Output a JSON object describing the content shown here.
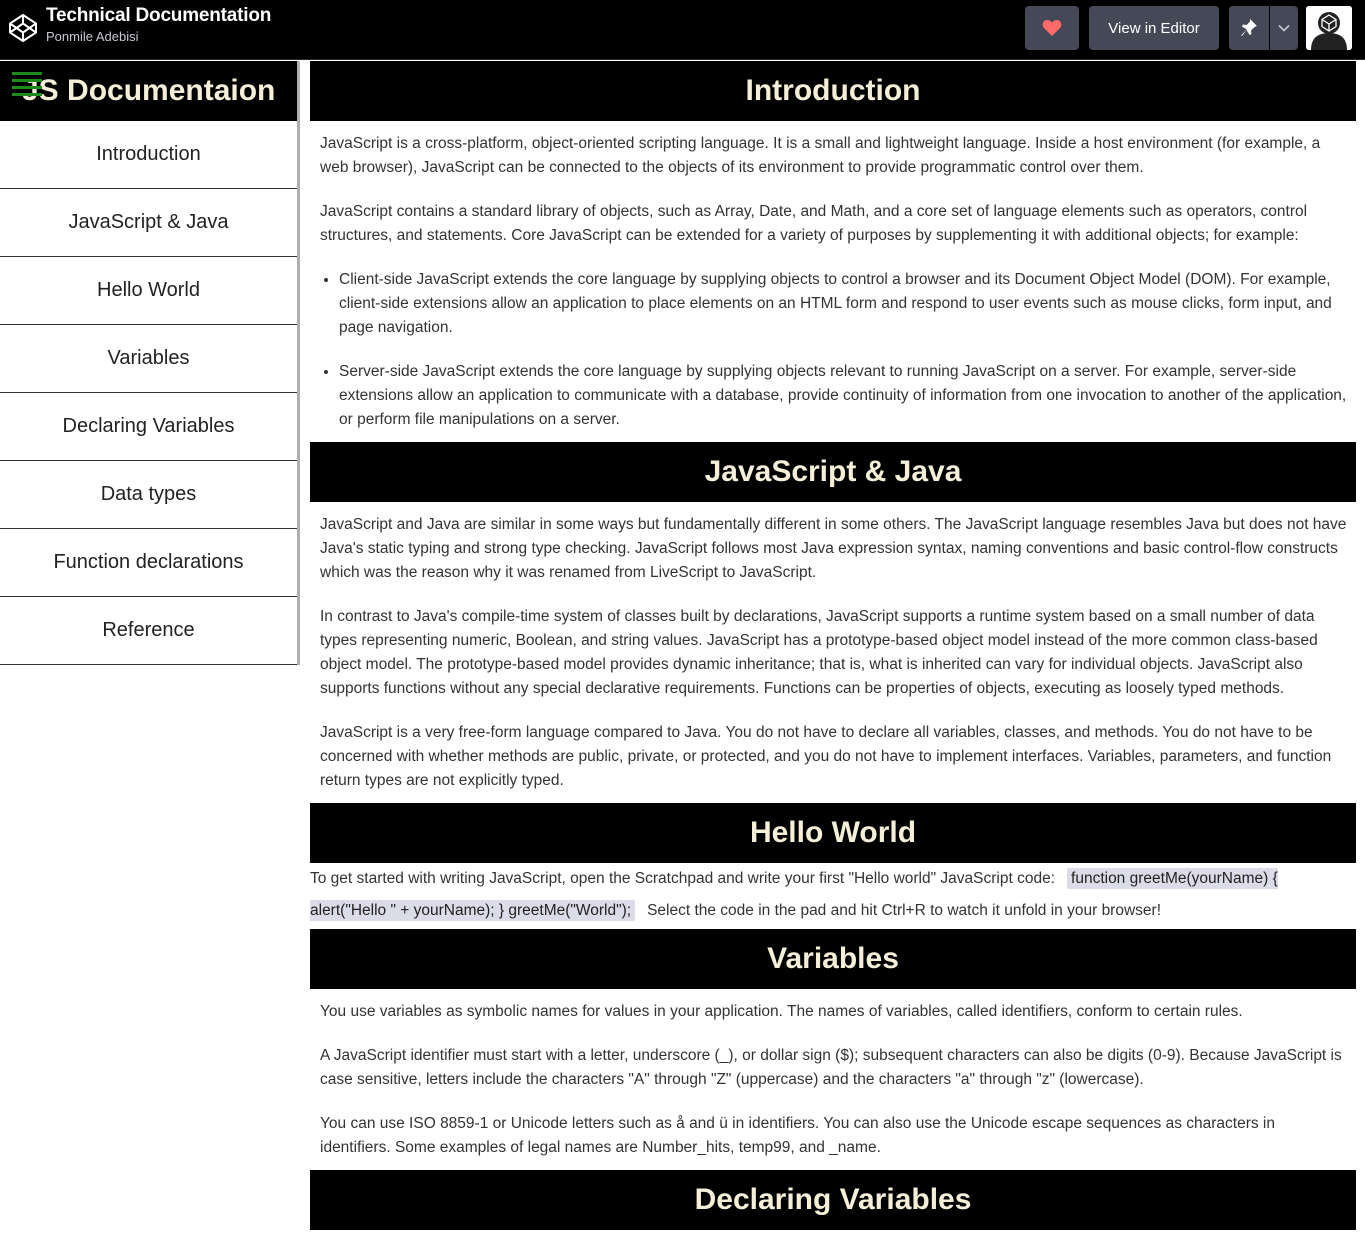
{
  "topbar": {
    "title": "Technical Documentation",
    "author": "Ponmile Adebisi",
    "editor_label": "View in Editor",
    "icons": [
      "codepen-logo-icon",
      "heart-icon",
      "pin-icon",
      "chevron-down-icon",
      "codepen-avatar-icon"
    ],
    "heart_color": "#ff6b6b"
  },
  "sidebar": {
    "title": "JS Documentaion",
    "items": [
      {
        "label": "Introduction"
      },
      {
        "label": "JavaScript & Java"
      },
      {
        "label": "Hello World"
      },
      {
        "label": "Variables"
      },
      {
        "label": "Declaring Variables"
      },
      {
        "label": "Data types"
      },
      {
        "label": "Function declarations"
      },
      {
        "label": "Reference"
      }
    ]
  },
  "sections": {
    "intro": {
      "title": "Introduction",
      "p1": "JavaScript is a cross-platform, object-oriented scripting language. It is a small and lightweight language. Inside a host environment (for example, a web browser), JavaScript can be connected to the objects of its environment to provide programmatic control over them.",
      "p2": "JavaScript contains a standard library of objects, such as Array, Date, and Math, and a core set of language elements such as operators, control structures, and statements. Core JavaScript can be extended for a variety of purposes by supplementing it with additional objects; for example:",
      "li1": "Client-side JavaScript extends the core language by supplying objects to control a browser and its Document Object Model (DOM). For example, client-side extensions allow an application to place elements on an HTML form and respond to user events such as mouse clicks, form input, and page navigation.",
      "li2": "Server-side JavaScript extends the core language by supplying objects relevant to running JavaScript on a server. For example, server-side extensions allow an application to communicate with a database, provide continuity of information from one invocation to another of the application, or perform file manipulations on a server."
    },
    "java": {
      "title": "JavaScript & Java",
      "p1": "JavaScript and Java are similar in some ways but fundamentally different in some others. The JavaScript language resembles Java but does not have Java's static typing and strong type checking. JavaScript follows most Java expression syntax, naming conventions and basic control-flow constructs which was the reason why it was renamed from LiveScript to JavaScript.",
      "p2": "In contrast to Java's compile-time system of classes built by declarations, JavaScript supports a runtime system based on a small number of data types representing numeric, Boolean, and string values. JavaScript has a prototype-based object model instead of the more common class-based object model. The prototype-based model provides dynamic inheritance; that is, what is inherited can vary for individual objects. JavaScript also supports functions without any special declarative requirements. Functions can be properties of objects, executing as loosely typed methods.",
      "p3": "JavaScript is a very free-form language compared to Java. You do not have to declare all variables, classes, and methods. You do not have to be concerned with whether methods are public, private, or protected, and you do not have to implement interfaces. Variables, parameters, and function return types are not explicitly typed."
    },
    "hello": {
      "title": "Hello World",
      "text_before": "To get started with writing JavaScript, open the Scratchpad and write your first \"Hello world\" JavaScript code:",
      "code": "function greetMe(yourName) { alert(\"Hello \" + yourName); } greetMe(\"World\");",
      "text_after": "Select the code in the pad and hit Ctrl+R to watch it unfold in your browser!"
    },
    "variables": {
      "title": "Variables",
      "p1": "You use variables as symbolic names for values in your application. The names of variables, called identifiers, conform to certain rules.",
      "p2": "A JavaScript identifier must start with a letter, underscore (_), or dollar sign ($); subsequent characters can also be digits (0-9). Because JavaScript is case sensitive, letters include the characters \"A\" through \"Z\" (uppercase) and the characters \"a\" through \"z\" (lowercase).",
      "p3": "You can use ISO 8859-1 or Unicode letters such as å and ü in identifiers. You can also use the Unicode escape sequences as characters in identifiers. Some examples of legal names are Number_hits, temp99, and _name."
    },
    "declaring": {
      "title": "Declaring Variables"
    }
  }
}
